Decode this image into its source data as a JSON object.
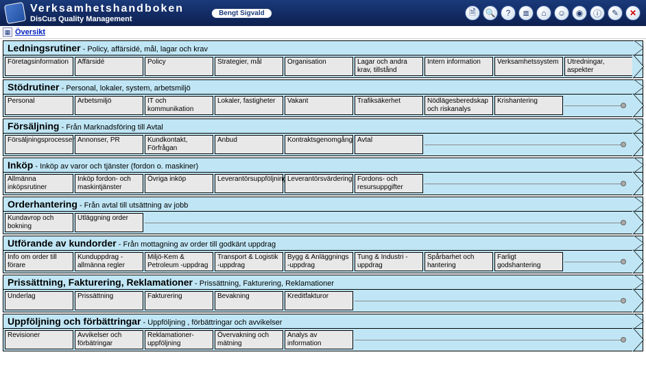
{
  "header": {
    "title": "Verksamhetshandboken",
    "subtitle": "DisCus Quality Management",
    "user": "Bengt Sigvald"
  },
  "toolbar": [
    {
      "name": "doc-icon",
      "glyph": "🗎"
    },
    {
      "name": "search-icon",
      "glyph": "🔍"
    },
    {
      "name": "help-icon",
      "glyph": "?"
    },
    {
      "name": "list-icon",
      "glyph": "≣"
    },
    {
      "name": "home-icon",
      "glyph": "⌂"
    },
    {
      "name": "person-icon",
      "glyph": "☺"
    },
    {
      "name": "globe-icon",
      "glyph": "◉"
    },
    {
      "name": "info-icon",
      "glyph": "ⓘ"
    },
    {
      "name": "tools-icon",
      "glyph": "✎"
    },
    {
      "name": "close-icon",
      "glyph": "✕"
    }
  ],
  "overview_label": "Översikt",
  "sections": [
    {
      "title": "Ledningsrutiner",
      "desc": " - Policy, affärsidé, mål, lagar och krav",
      "boxes": [
        "Företagsinformation",
        "Affärsidé",
        "Policy",
        "Strategier, mål",
        "Organisation",
        "Lagar och andra krav, tillstånd",
        "Intern information",
        "Verksamhetssystem",
        "Utredningar, aspekter"
      ],
      "filler": false
    },
    {
      "title": "Stödrutiner",
      "desc": " - Personal, lokaler, system, arbetsmiljö",
      "boxes": [
        "Personal",
        "Arbetsmiljö",
        "IT och kommunikation",
        "Lokaler, fastigheter",
        "Vakant",
        "Trafiksäkerhet",
        "Nödlägesberedskap och riskanalys",
        "Krishantering"
      ],
      "filler": true
    },
    {
      "title": "Försäljning",
      "desc": " - Från Marknadsföring till Avtal",
      "boxes": [
        "Försäljningsprocessen",
        "Annonser, PR",
        "Kundkontakt, Förfrågan",
        "Anbud",
        "Kontraktsgenomgång",
        "Avtal"
      ],
      "filler": true
    },
    {
      "title": "Inköp",
      "desc": " - Inköp av varor och tjänster (fordon o. maskiner)",
      "boxes": [
        "Allmänna inköpsrutiner",
        "Inköp fordon- och maskintjänster",
        "Övriga inköp",
        "Leverantörsuppföljning",
        "Leverantörsvärdering",
        "Fordons- och resursuppgifter"
      ],
      "filler": true
    },
    {
      "title": "Orderhantering",
      "desc": " - Från avtal till utsättning av jobb",
      "boxes": [
        "Kundavrop och bokning",
        "Utläggning order"
      ],
      "filler": true
    },
    {
      "title": "Utförande av kundorder",
      "desc": " - Från mottagning av order till godkänt uppdrag",
      "boxes": [
        "Info om order till förare",
        "Kunduppdrag -allmänna regler",
        "Miljö-Kem & Petroleum -uppdrag",
        "Transport & Logistik -uppdrag",
        "Bygg & Anläggnings -uppdrag",
        "Tung & Industri -uppdrag",
        "Spårbarhet och hantering",
        "Farligt godshantering"
      ],
      "filler": true
    },
    {
      "title": "Prissättning, Fakturering, Reklamationer",
      "desc": " - Prissättning, Fakturering, Reklamationer",
      "boxes": [
        "Underlag",
        "Prissättning",
        "Fakturering",
        "Bevakning",
        "Kreditfakturor"
      ],
      "filler": true
    },
    {
      "title": "Uppföljning och förbättringar",
      "desc": " - Uppföljning , förbättringar och avvikelser",
      "boxes": [
        "Revisioner",
        "Avvikelser och förbätringar",
        "Reklamationer- uppföljning",
        "Övervakning och mätning",
        "Analys av information"
      ],
      "filler": true
    }
  ]
}
